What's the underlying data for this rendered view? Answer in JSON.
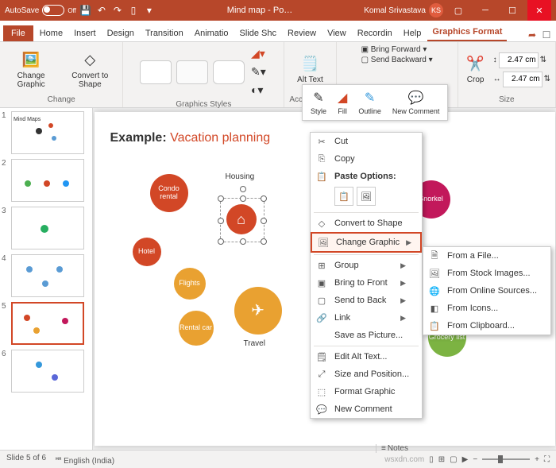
{
  "titlebar": {
    "autosave_label": "AutoSave",
    "autosave_state": "Off",
    "doc_title": "Mind map - Po…",
    "user_name": "Komal Srivastava",
    "user_initials": "KS"
  },
  "tabs": {
    "file": "File",
    "home": "Home",
    "insert": "Insert",
    "design": "Design",
    "transitions": "Transition",
    "animations": "Animatio",
    "slideshow": "Slide Shc",
    "review": "Review",
    "view": "View",
    "recording": "Recordin",
    "help": "Help",
    "graphics_format": "Graphics Format"
  },
  "ribbon": {
    "change_graphic": "Change\nGraphic",
    "convert_shape": "Convert\nto Shape",
    "group_change": "Change",
    "group_styles": "Graphics Styles",
    "alt_text": "Alt\nText",
    "group_access": "Accessibi…",
    "bring_forward": "Bring Forward",
    "send_backward": "Send Backward",
    "crop": "Crop",
    "height": "2.47 cm",
    "width": "2.47 cm",
    "group_size": "Size"
  },
  "float_toolbar": {
    "style": "Style",
    "fill": "Fill",
    "outline": "Outline",
    "new_comment": "New\nComment"
  },
  "context_menu": {
    "cut": "Cut",
    "copy": "Copy",
    "paste_options": "Paste Options:",
    "convert_to_shape": "Convert to Shape",
    "change_graphic": "Change Graphic",
    "group": "Group",
    "bring_to_front": "Bring to Front",
    "send_to_back": "Send to Back",
    "link": "Link",
    "save_as_picture": "Save as Picture...",
    "edit_alt_text": "Edit Alt Text...",
    "size_and_position": "Size and Position...",
    "format_graphic": "Format Graphic",
    "new_comment": "New Comment"
  },
  "submenu": {
    "from_file": "From a File...",
    "from_stock": "From Stock Images...",
    "from_online": "From Online Sources...",
    "from_icons": "From Icons...",
    "from_clipboard": "From Clipboard..."
  },
  "slide": {
    "title_prefix": "Example:",
    "title_main": " Vacation planning",
    "housing": "Housing",
    "condo": "Condo\nrental",
    "hotel": "Hotel",
    "flights": "Flights",
    "rental_car": "Rental\ncar",
    "travel": "Travel",
    "snorkel": "Snorkel",
    "grocery": "Grocery\nlist"
  },
  "thumbs": {
    "t1": "Mind Maps"
  },
  "status": {
    "slide_of": "Slide 5 of 6",
    "lang": "English (India)",
    "notes": "Notes",
    "watermark": "wsxdn.com"
  }
}
